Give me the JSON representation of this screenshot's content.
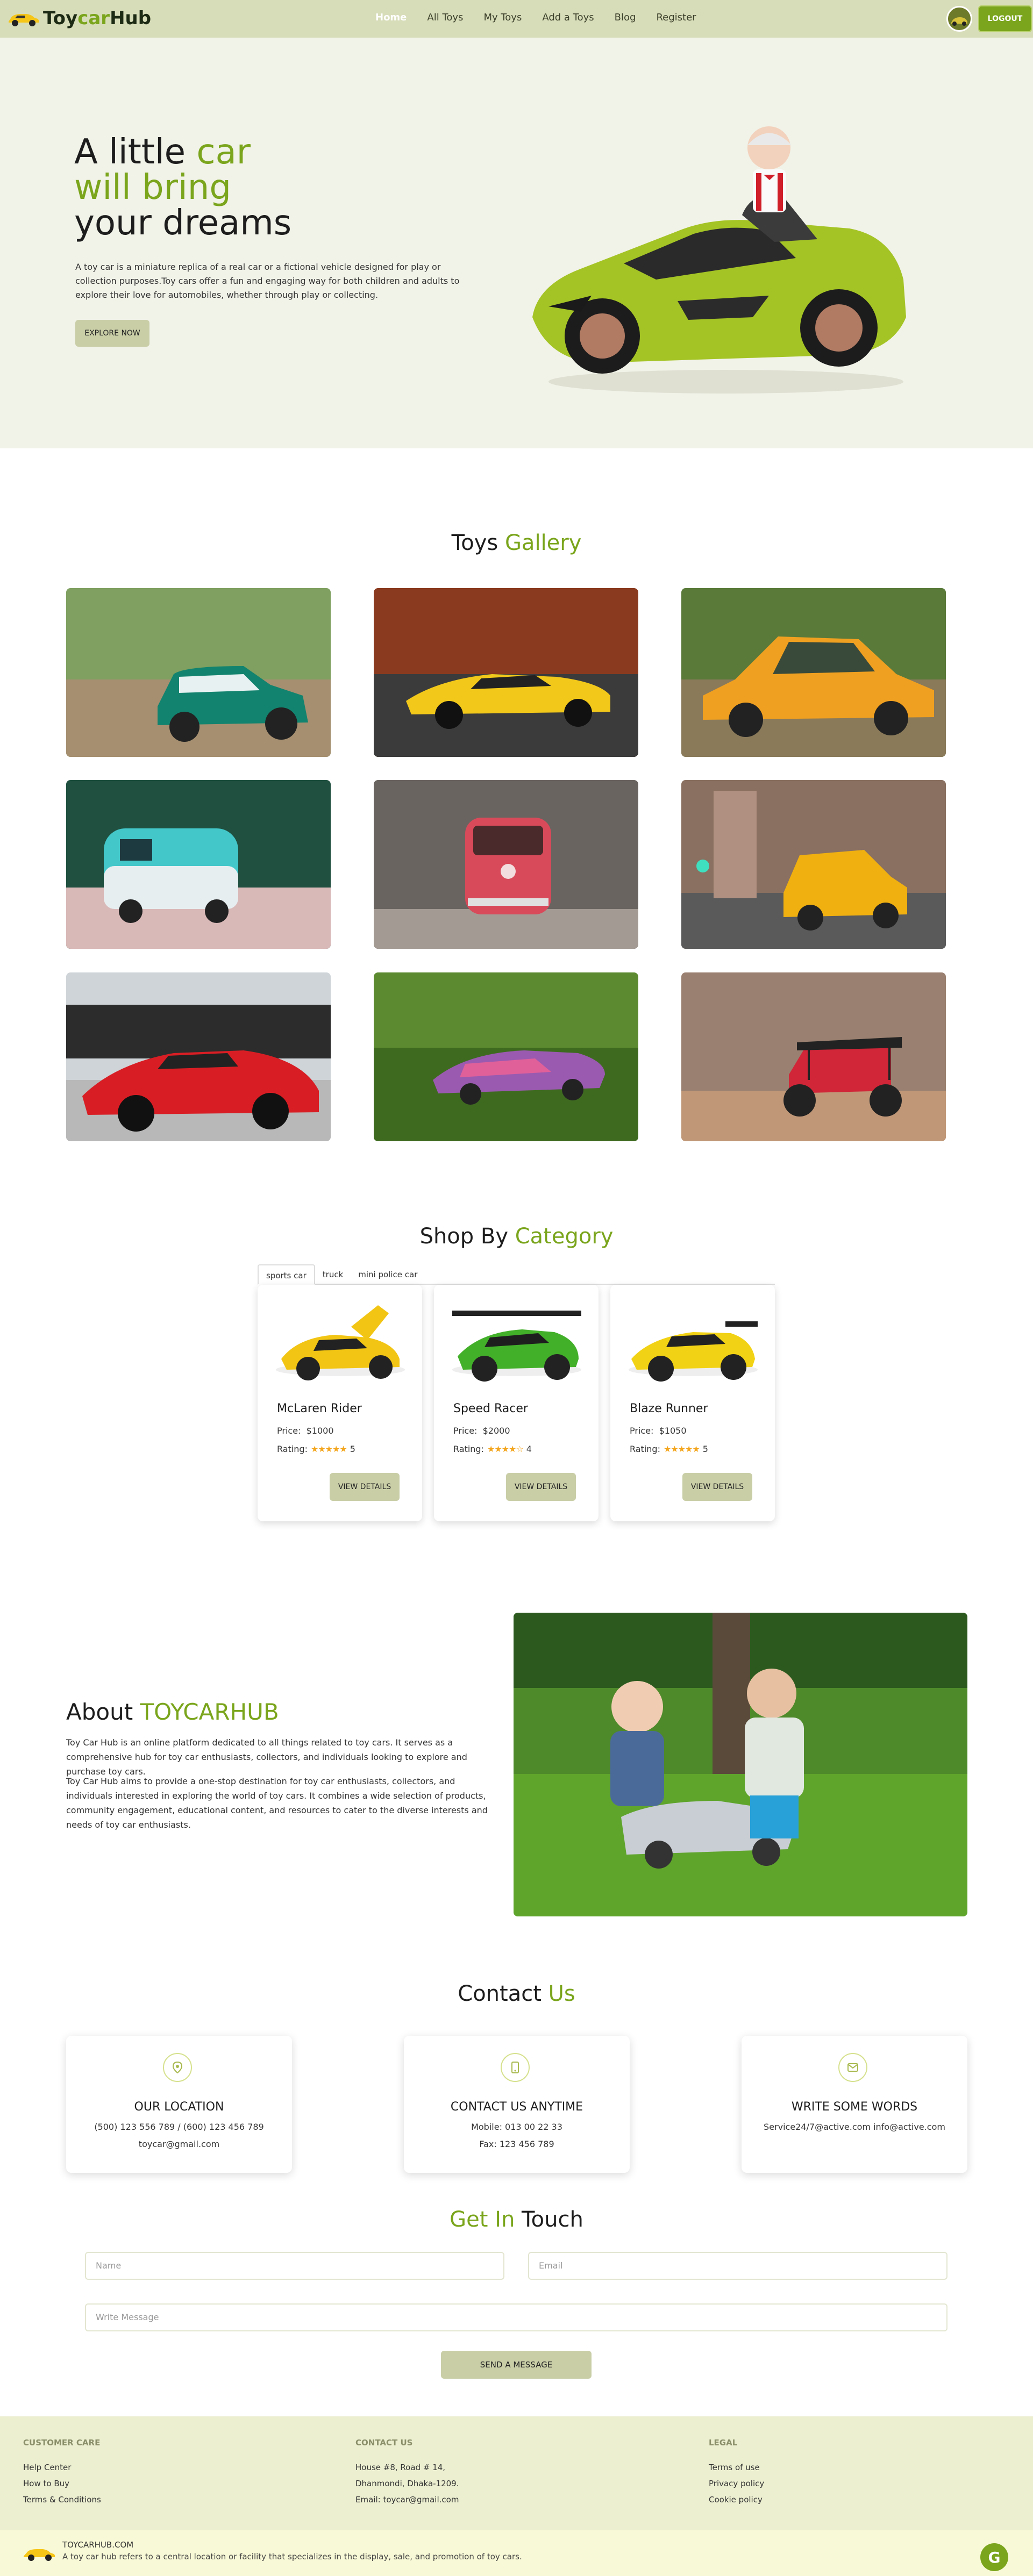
{
  "nav": {
    "logo_prefix": "Toy",
    "logo_car": "car",
    "logo_suffix": "Hub",
    "links": [
      "Home",
      "All Toys",
      "My Toys",
      "Add a Toys",
      "Blog",
      "Register"
    ],
    "logout_label": "LOGOUT"
  },
  "hero": {
    "line1": "A little ",
    "line1_accent": "car",
    "line2_accent": "will bring",
    "line3": "your dreams",
    "description": "A toy car is a miniature replica of a real car or a fictional vehicle designed for play or collection purposes.Toy cars offer a fun and engaging way for both children and adults to explore their love for automobiles, whether through play or collecting.",
    "cta_label": "EXPLORE NOW"
  },
  "gallery": {
    "title": "Toys ",
    "title_accent": "Gallery"
  },
  "category": {
    "title": "Shop By ",
    "title_accent": "Category",
    "tabs": [
      "sports car",
      "truck",
      "mini police car"
    ],
    "products": [
      {
        "name": "McLaren Rider",
        "price_label": "Price:",
        "price": "$1000",
        "rating_label": "Rating:",
        "stars": "★★★★★",
        "rating": "5",
        "button": "VIEW DETAILS"
      },
      {
        "name": "Speed Racer",
        "price_label": "Price:",
        "price": "$2000",
        "rating_label": "Rating:",
        "stars": "★★★★☆",
        "rating": "4",
        "button": "VIEW DETAILS"
      },
      {
        "name": "Blaze Runner",
        "price_label": "Price:",
        "price": "$1050",
        "rating_label": "Rating:",
        "stars": "★★★★★",
        "rating": "5",
        "button": "VIEW DETAILS"
      }
    ]
  },
  "about": {
    "title": "About ",
    "title_accent": "TOYCARHUB",
    "p1": "Toy Car Hub is an online platform dedicated to all things related to toy cars. It serves as a comprehensive hub for toy car enthusiasts, collectors, and individuals looking to explore and purchase toy cars.",
    "p2": "Toy Car Hub aims to provide a one-stop destination for toy car enthusiasts, collectors, and individuals interested in exploring the world of toy cars. It combines a wide selection of products, community engagement, educational content, and resources to cater to the diverse interests and needs of toy car enthusiasts."
  },
  "contact": {
    "title": "Contact ",
    "title_accent": "Us",
    "cards": [
      {
        "heading": "OUR LOCATION",
        "line1": "(500) 123 556 789 / (600) 123 456 789",
        "line2": "toycar@gmail.com"
      },
      {
        "heading": "CONTACT US ANYTIME",
        "line1": "Mobile: 013 00 22 33",
        "line2": "Fax: 123 456 789"
      },
      {
        "heading": "WRITE SOME WORDS",
        "line1": "Service24/7@active.com info@active.com",
        "line2": ""
      }
    ]
  },
  "touch": {
    "title_accent": "Get In",
    "title": " Touch",
    "name_placeholder": "Name",
    "email_placeholder": "Email",
    "message_placeholder": "Write Message",
    "send_label": "SEND A MESSAGE"
  },
  "footer": {
    "col1_head": "CUSTOMER CARE",
    "col1_items": [
      "Help Center",
      "How to Buy",
      "Terms & Conditions"
    ],
    "col2_head": "CONTACT US",
    "col2_items": [
      "House #8, Road # 14,",
      "Dhanmondi, Dhaka-1209.",
      "Email: toycar@gmail.com"
    ],
    "col3_head": "LEGAL",
    "col3_items": [
      "Terms of use",
      "Privacy policy",
      "Cookie policy"
    ],
    "brand": "TOYCARHUB.COM",
    "brand_desc": "A toy car hub refers to a central location or facility that specializes in the display, sale, and promotion of toy cars.",
    "google_letter": "G"
  },
  "colors": {
    "accent": "#7aa51c",
    "nav_bg": "#d8ddb9",
    "button_bg": "#c9cea7",
    "footer_bg": "#ecefd0"
  }
}
